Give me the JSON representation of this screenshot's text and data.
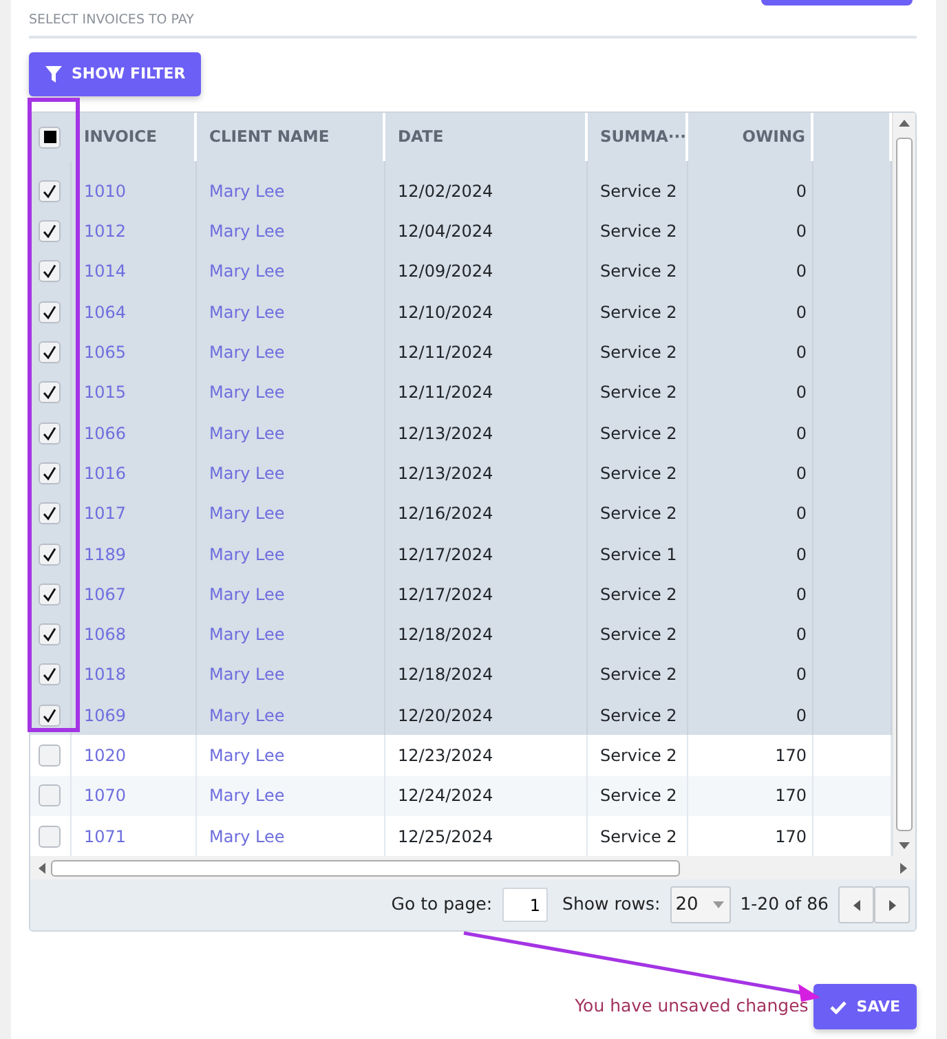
{
  "section_title": "SELECT INVOICES TO PAY",
  "filter_button": {
    "label": "SHOW FILTER"
  },
  "table": {
    "select_all": {
      "indeterminate": true
    },
    "columns": [
      "INVOICE",
      "CLIENT NAME",
      "DATE",
      "SUMMA···",
      "OWING"
    ],
    "rows": [
      {
        "invoice": "1010",
        "client": "Mary Lee",
        "date": "12/02/2024",
        "summary": "Service 2",
        "owing": "0",
        "selected": true
      },
      {
        "invoice": "1012",
        "client": "Mary Lee",
        "date": "12/04/2024",
        "summary": "Service 2",
        "owing": "0",
        "selected": true
      },
      {
        "invoice": "1014",
        "client": "Mary Lee",
        "date": "12/09/2024",
        "summary": "Service 2",
        "owing": "0",
        "selected": true
      },
      {
        "invoice": "1064",
        "client": "Mary Lee",
        "date": "12/10/2024",
        "summary": "Service 2",
        "owing": "0",
        "selected": true
      },
      {
        "invoice": "1065",
        "client": "Mary Lee",
        "date": "12/11/2024",
        "summary": "Service 2",
        "owing": "0",
        "selected": true
      },
      {
        "invoice": "1015",
        "client": "Mary Lee",
        "date": "12/11/2024",
        "summary": "Service 2",
        "owing": "0",
        "selected": true
      },
      {
        "invoice": "1066",
        "client": "Mary Lee",
        "date": "12/13/2024",
        "summary": "Service 2",
        "owing": "0",
        "selected": true
      },
      {
        "invoice": "1016",
        "client": "Mary Lee",
        "date": "12/13/2024",
        "summary": "Service 2",
        "owing": "0",
        "selected": true
      },
      {
        "invoice": "1017",
        "client": "Mary Lee",
        "date": "12/16/2024",
        "summary": "Service 2",
        "owing": "0",
        "selected": true
      },
      {
        "invoice": "1189",
        "client": "Mary Lee",
        "date": "12/17/2024",
        "summary": "Service 1",
        "owing": "0",
        "selected": true
      },
      {
        "invoice": "1067",
        "client": "Mary Lee",
        "date": "12/17/2024",
        "summary": "Service 2",
        "owing": "0",
        "selected": true
      },
      {
        "invoice": "1068",
        "client": "Mary Lee",
        "date": "12/18/2024",
        "summary": "Service 2",
        "owing": "0",
        "selected": true
      },
      {
        "invoice": "1018",
        "client": "Mary Lee",
        "date": "12/18/2024",
        "summary": "Service 2",
        "owing": "0",
        "selected": true
      },
      {
        "invoice": "1069",
        "client": "Mary Lee",
        "date": "12/20/2024",
        "summary": "Service 2",
        "owing": "0",
        "selected": true
      },
      {
        "invoice": "1020",
        "client": "Mary Lee",
        "date": "12/23/2024",
        "summary": "Service 2",
        "owing": "170",
        "selected": false
      },
      {
        "invoice": "1070",
        "client": "Mary Lee",
        "date": "12/24/2024",
        "summary": "Service 2",
        "owing": "170",
        "selected": false
      },
      {
        "invoice": "1071",
        "client": "Mary Lee",
        "date": "12/25/2024",
        "summary": "Service 2",
        "owing": "170",
        "selected": false
      }
    ]
  },
  "pager": {
    "goto_label": "Go to page:",
    "page": "1",
    "rows_label": "Show rows:",
    "rows_per_page": "20",
    "range": "1-20 of 86"
  },
  "status": "You have unsaved changes",
  "save_button": {
    "label": "SAVE"
  }
}
